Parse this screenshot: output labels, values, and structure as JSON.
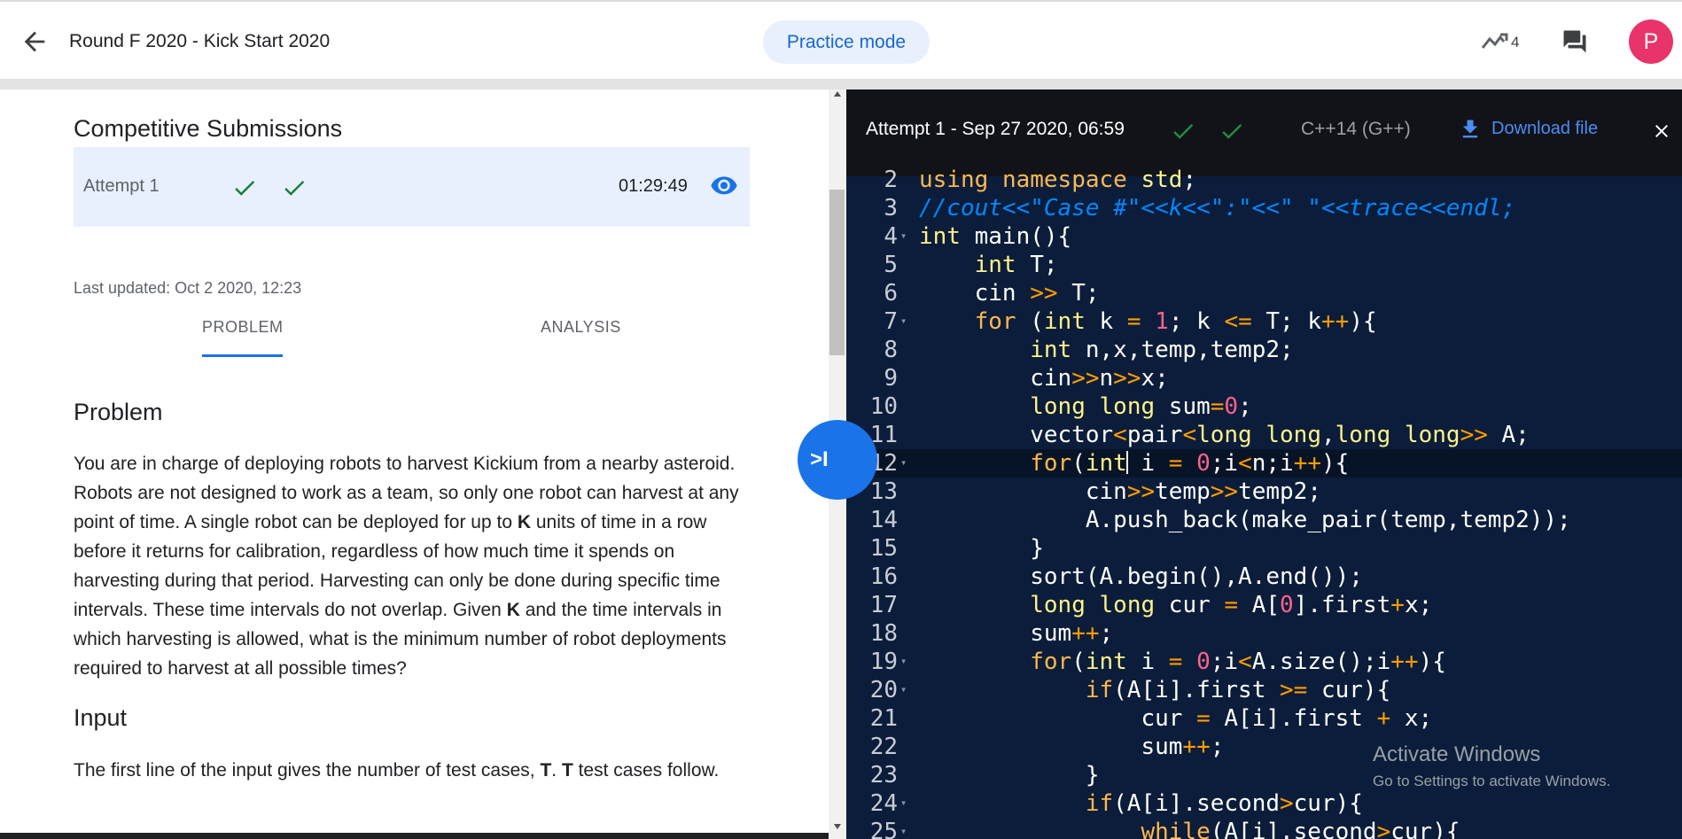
{
  "header": {
    "title": "Round F 2020 - Kick Start 2020",
    "mode_label": "Practice mode",
    "trend_count": "4",
    "avatar_letter": "P",
    "icons": [
      "back-arrow-icon",
      "trending-icon",
      "chat-icon"
    ]
  },
  "submissions": {
    "title": "Competitive Submissions",
    "attempt_label": "Attempt 1",
    "attempt_time": "01:29:49",
    "last_updated": "Last updated: Oct 2 2020, 12:23"
  },
  "tabs": [
    {
      "label": "PROBLEM",
      "active": true
    },
    {
      "label": "ANALYSIS",
      "active": false
    }
  ],
  "problem": {
    "heading": "Problem",
    "text_1": "You are in charge of deploying robots to harvest Kickium from a nearby asteroid. Robots are not designed to work as a team, so only one robot can harvest at any point of time. A single robot can be deployed for up to ",
    "bold_k": "K",
    "text_2": " units of time in a row before it returns for calibration, regardless of how much time it spends on harvesting during that period. Harvesting can only be done during specific time intervals. These time intervals do not overlap. Given ",
    "text_3": " and the time intervals in which harvesting is allowed, what is the minimum number of robot deployments required to harvest at all possible times?"
  },
  "input": {
    "heading": "Input",
    "text_1": "The first line of the input gives the number of test cases, ",
    "bold_t": "T",
    "text_2": ". ",
    "text_3": " test cases follow."
  },
  "toggle_label": ">I",
  "viewer": {
    "title": "Attempt 1 - Sep 27 2020, 06:59",
    "language": "C++14 (G++)",
    "download_label": "Download file",
    "close_label": "✕"
  },
  "code_lines": [
    {
      "n": "2",
      "fold": false,
      "text": "using namespace std;"
    },
    {
      "n": "3",
      "fold": false,
      "text": "//cout<<\"Case #\"<<k<<\":\"<<\" \"<<trace<<endl;"
    },
    {
      "n": "4",
      "fold": true,
      "text": "int main(){"
    },
    {
      "n": "5",
      "fold": false,
      "text": "    int T;"
    },
    {
      "n": "6",
      "fold": false,
      "text": "    cin >> T;"
    },
    {
      "n": "7",
      "fold": true,
      "text": "    for (int k = 1; k <= T; k++){"
    },
    {
      "n": "8",
      "fold": false,
      "text": "        int n,x,temp,temp2;"
    },
    {
      "n": "9",
      "fold": false,
      "text": "        cin>>n>>x;"
    },
    {
      "n": "10",
      "fold": false,
      "text": "        long long sum=0;"
    },
    {
      "n": "11",
      "fold": false,
      "text": "        vector<pair<long long,long long>> A;"
    },
    {
      "n": "12",
      "fold": true,
      "text": "        for(int i = 0;i<n;i++){"
    },
    {
      "n": "13",
      "fold": false,
      "text": "            cin>>temp>>temp2;"
    },
    {
      "n": "14",
      "fold": false,
      "text": "            A.push_back(make_pair(temp,temp2));"
    },
    {
      "n": "15",
      "fold": false,
      "text": "        }"
    },
    {
      "n": "16",
      "fold": false,
      "text": "        sort(A.begin(),A.end());"
    },
    {
      "n": "17",
      "fold": false,
      "text": "        long long cur = A[0].first+x;"
    },
    {
      "n": "18",
      "fold": false,
      "text": "        sum++;"
    },
    {
      "n": "19",
      "fold": true,
      "text": "        for(int i = 0;i<A.size();i++){"
    },
    {
      "n": "20",
      "fold": true,
      "text": "            if(A[i].first >= cur){"
    },
    {
      "n": "21",
      "fold": false,
      "text": "                cur = A[i].first + x;"
    },
    {
      "n": "22",
      "fold": false,
      "text": "                sum++;"
    },
    {
      "n": "23",
      "fold": false,
      "text": "            }"
    },
    {
      "n": "24",
      "fold": true,
      "text": "            if(A[i].second>cur){"
    },
    {
      "n": "25",
      "fold": true,
      "text": "                while(A[i].second>cur){"
    }
  ],
  "watermark": {
    "title": "Activate Windows",
    "subtitle": "Go to Settings to activate Windows."
  },
  "colors": {
    "accent": "#1a73e8",
    "success": "#188038",
    "code_bg": "#0b1d3a",
    "keyword": "#ffb84d",
    "type": "#fff28a",
    "number": "#ff628c",
    "comment": "#0088ff"
  }
}
